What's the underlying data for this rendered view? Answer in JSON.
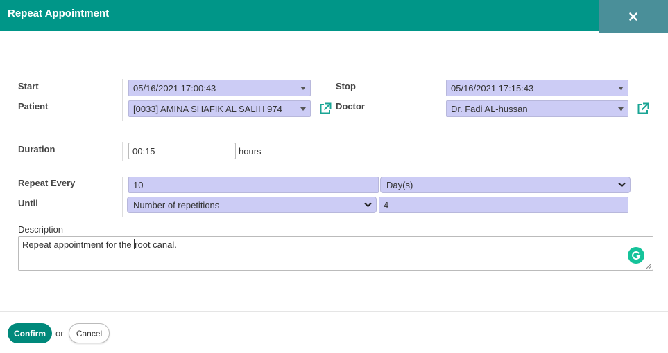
{
  "dialog": {
    "title": "Repeat Appointment",
    "close_icon": "close-icon"
  },
  "labels": {
    "start": "Start",
    "stop": "Stop",
    "patient": "Patient",
    "doctor": "Doctor",
    "duration": "Duration",
    "repeat_every": "Repeat Every",
    "until": "Until",
    "description": "Description"
  },
  "fields": {
    "start_value": "05/16/2021 17:00:43",
    "stop_value": "05/16/2021 17:15:43",
    "patient_value": "[0033]  AMINA SHAFIK AL SALIH   974",
    "doctor_value": "Dr. Fadi AL-hussan",
    "duration_value": "00:15",
    "duration_unit": "hours",
    "repeat_every_value": "10",
    "repeat_unit_value": "Day(s)",
    "until_mode_value": "Number of repetitions",
    "until_count_value": "4",
    "description_before_cursor": "Repeat appointment for the ",
    "description_after_cursor": "root canal."
  },
  "footer": {
    "confirm_label": "Confirm",
    "or_text": "or",
    "cancel_label": "Cancel"
  },
  "colors": {
    "header": "#009688",
    "close_bg": "#4a8f99",
    "field_bg": "#ccccf5",
    "accent": "#00897b",
    "grammarly": "#15c39a"
  }
}
